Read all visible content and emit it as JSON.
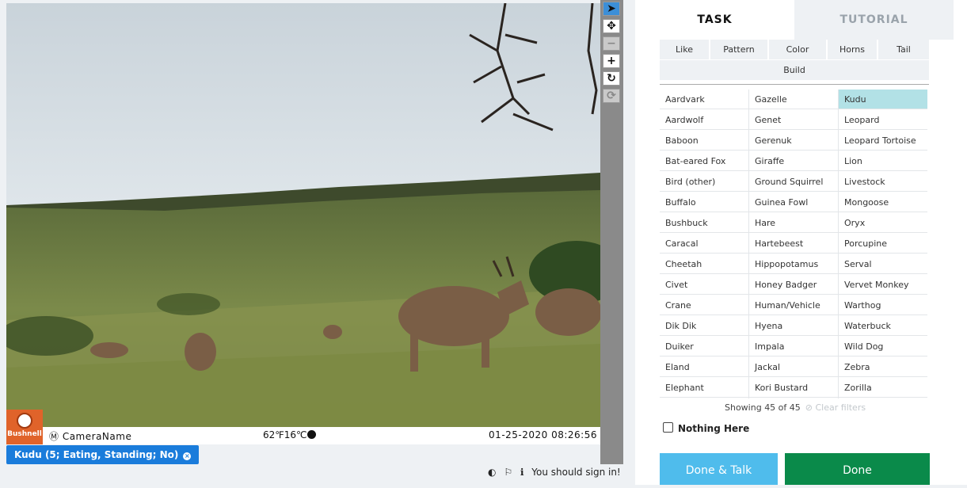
{
  "image": {
    "camera_name": "CameraName",
    "temperature": "62℉16℃",
    "timestamp": "01-25-2020 08:26:56",
    "brand": "Bushnell"
  },
  "toolbar": {
    "icons": [
      "pointer-icon",
      "move-icon",
      "zoom-out-icon",
      "zoom-in-icon",
      "rotate-icon",
      "reset-icon"
    ]
  },
  "annotation_chip": {
    "label": "Kudu (5; Eating, Standing; No)",
    "remove": "×"
  },
  "footer": {
    "invert_icon": "◐",
    "flag_icon": "⚐",
    "info_icon": "ℹ",
    "signin_text": "You should sign in!"
  },
  "tabs": {
    "task": "TASK",
    "tutorial": "TUTORIAL"
  },
  "filters": [
    "Like",
    "Pattern",
    "Color",
    "Horns",
    "Tail",
    "Build"
  ],
  "species": {
    "col1": [
      "Aardvark",
      "Aardwolf",
      "Baboon",
      "Bat-eared Fox",
      "Bird (other)",
      "Buffalo",
      "Bushbuck",
      "Caracal",
      "Cheetah",
      "Civet",
      "Crane",
      "Dik Dik",
      "Duiker",
      "Eland",
      "Elephant"
    ],
    "col2": [
      "Gazelle",
      "Genet",
      "Gerenuk",
      "Giraffe",
      "Ground Squirrel",
      "Guinea Fowl",
      "Hare",
      "Hartebeest",
      "Hippopotamus",
      "Honey Badger",
      "Human/Vehicle",
      "Hyena",
      "Impala",
      "Jackal",
      "Kori Bustard"
    ],
    "col3": [
      "Kudu",
      "Leopard",
      "Leopard Tortoise",
      "Lion",
      "Livestock",
      "Mongoose",
      "Oryx",
      "Porcupine",
      "Serval",
      "Vervet Monkey",
      "Warthog",
      "Waterbuck",
      "Wild Dog",
      "Zebra",
      "Zorilla"
    ],
    "selected": "Kudu"
  },
  "showing": {
    "text": "Showing 45 of 45",
    "clear": "⊘ Clear filters"
  },
  "nothing_here": "Nothing Here",
  "buttons": {
    "done_talk": "Done & Talk",
    "done": "Done"
  },
  "colors": {
    "accent_blue": "#1a7cdb",
    "done_green": "#0a8a4a",
    "done_talk_blue": "#4fbcec",
    "selected_cell": "#b2e1e6"
  }
}
